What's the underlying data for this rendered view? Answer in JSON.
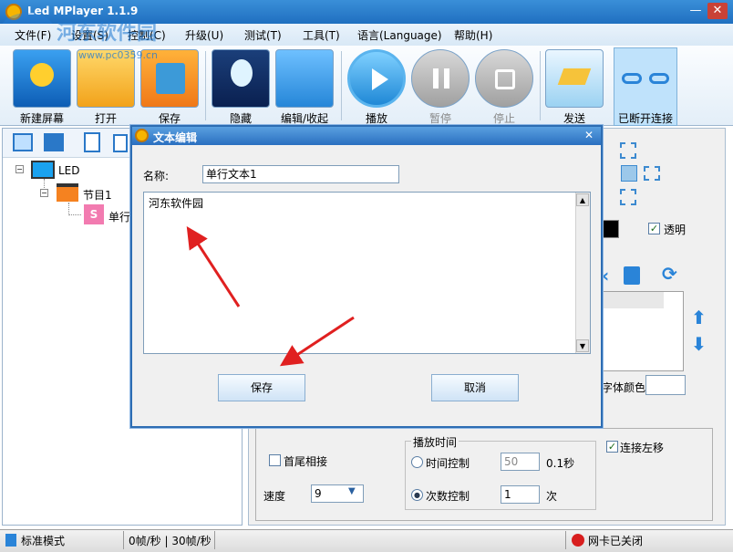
{
  "app": {
    "title": "Led MPlayer 1.1.9",
    "minimize": "—",
    "close": "✕"
  },
  "watermark": {
    "line1": "河东软件园",
    "line2": "www.pc0359.cn"
  },
  "menu": [
    "文件(F)",
    "设置(S)",
    "控制(C)",
    "升级(U)",
    "测试(T)",
    "工具(T)",
    "语言(Language)",
    "帮助(H)"
  ],
  "toolbar": {
    "new_screen": "新建屏幕",
    "open": "打开",
    "save": "保存",
    "hide": "隐藏",
    "edit_collapse": "编辑/收起",
    "play": "播放",
    "pause": "暂停",
    "stop": "停止",
    "send": "发送",
    "disconnected": "已断开连接"
  },
  "tree": {
    "root": "LED",
    "program": "节目1",
    "item": "单行",
    "item_icon": "S"
  },
  "right": {
    "transparent": "透明",
    "font_color": "字体颜色",
    "head_tail": "首尾相接",
    "speed_label": "速度",
    "speed_value": "9",
    "play_time": "播放时间",
    "time_ctrl": "时间控制",
    "time_value": "50",
    "time_unit": "0.1秒",
    "count_ctrl": "次数控制",
    "count_value": "1",
    "count_unit": "次",
    "continuous_left": "连接左移"
  },
  "status": {
    "mode": "标准模式",
    "fps": "0帧/秒 | 30帧/秒",
    "card": "网卡已关闭"
  },
  "dialog": {
    "title": "文本编辑",
    "close": "✕",
    "name_label": "名称:",
    "name_value": "单行文本1",
    "text": "河东软件园",
    "save": "保存",
    "cancel": "取消"
  },
  "colors": {
    "accent": "#2a6fc0",
    "arrow": "#e02020"
  }
}
